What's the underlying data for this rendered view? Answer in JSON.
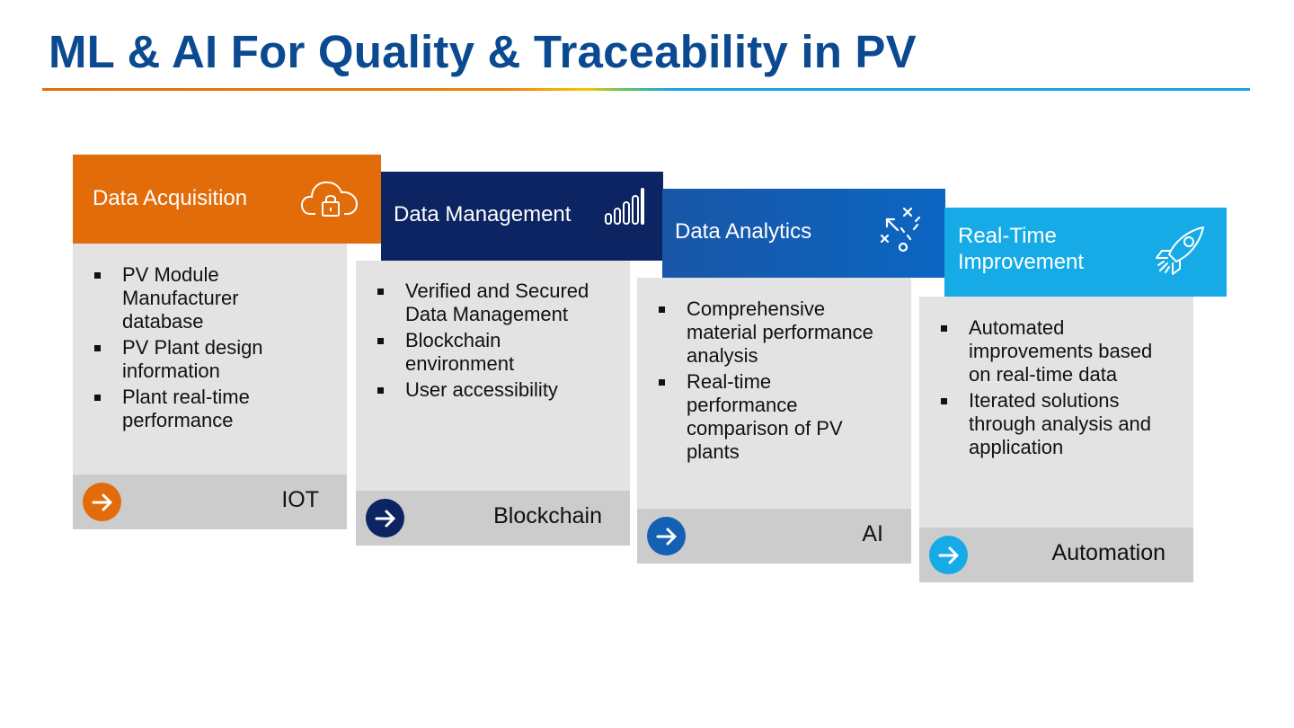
{
  "title": "ML & AI For Quality & Traceability in PV",
  "colors": {
    "title": "#0b4a91",
    "card1": "#e36c0a",
    "card2": "#0c2461",
    "card3": "#1461b3",
    "card4": "#16abe7",
    "body_bg": "#e3e3e3",
    "footer_bg": "#cccccc"
  },
  "cards": [
    {
      "title": "Data Acquisition",
      "icon": "cloud-lock-icon",
      "bullets": [
        "PV Module Manufacturer database",
        "PV Plant design information",
        "Plant real-time performance"
      ],
      "footer": "IOT"
    },
    {
      "title": "Data Management",
      "icon": "signal-bars-icon",
      "bullets": [
        "Verified and Secured Data Management",
        "Blockchain environment",
        "User accessibility"
      ],
      "footer": "Blockchain"
    },
    {
      "title": "Data Analytics",
      "icon": "strategy-play-icon",
      "bullets": [
        "Comprehensive material performance analysis",
        "Real-time performance comparison of PV plants"
      ],
      "footer": "AI"
    },
    {
      "title": "Real-Time Improvement",
      "icon": "rocket-icon",
      "bullets": [
        "Automated improvements based on real-time data",
        "Iterated solutions through analysis and application"
      ],
      "footer": "Automation"
    }
  ]
}
